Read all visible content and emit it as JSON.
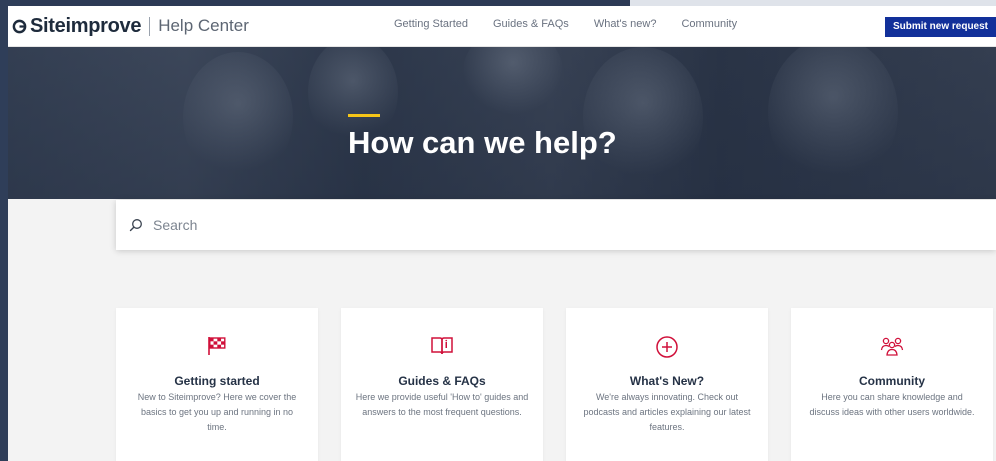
{
  "header": {
    "brand": "Siteimprove",
    "brand_sub": "Help Center",
    "nav": [
      "Getting Started",
      "Guides & FAQs",
      "What's new?",
      "Community"
    ],
    "submit_label": "Submit new request"
  },
  "hero": {
    "title": "How can we help?",
    "accent_color": "#f5c518"
  },
  "search": {
    "placeholder": "Search"
  },
  "cards": [
    {
      "icon": "checkered-flag-icon",
      "title": "Getting started",
      "desc": "New to Siteimprove? Here we cover the basics to get you up and running in no time."
    },
    {
      "icon": "book-icon",
      "title": "Guides & FAQs",
      "desc": "Here we provide useful 'How to' guides and answers to the most frequent questions."
    },
    {
      "icon": "plus-circle-icon",
      "title": "What's New?",
      "desc": "We're always innovating. Check out podcasts and articles explaining our latest features."
    },
    {
      "icon": "people-group-icon",
      "title": "Community",
      "desc": "Here you can share knowledge and discuss ideas with other users worldwide."
    }
  ],
  "colors": {
    "brand_navy": "#12309a",
    "icon_red": "#d0103a",
    "desktop_bg": "#2c3a55"
  }
}
